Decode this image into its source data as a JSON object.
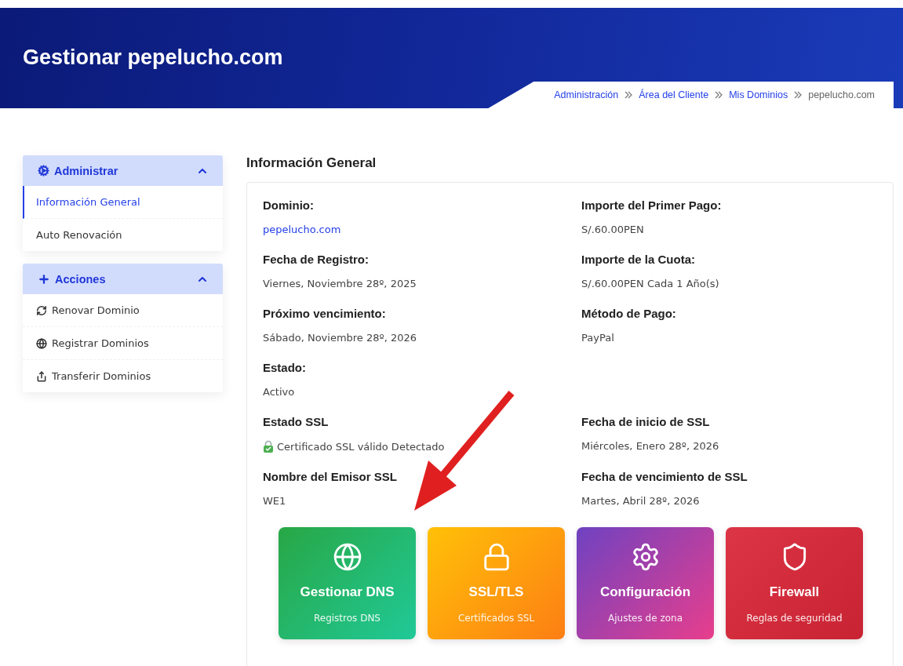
{
  "header": {
    "title": "Gestionar pepelucho.com"
  },
  "breadcrumb": [
    {
      "label": "Administración",
      "kind": "link"
    },
    {
      "label": "Área del Cliente",
      "kind": "link"
    },
    {
      "label": "Mis Dominios",
      "kind": "link"
    },
    {
      "label": "pepelucho.com",
      "kind": "current"
    }
  ],
  "sidebar": [
    {
      "title": "Administrar",
      "kind": "gear",
      "expanded": true,
      "items": [
        {
          "label": "Información General",
          "kind": "plain",
          "selected": true
        },
        {
          "label": "Auto Renovación",
          "kind": "plain",
          "selected": false
        }
      ]
    },
    {
      "title": "Acciones",
      "kind": "plus",
      "expanded": true,
      "items": [
        {
          "label": "Renovar Dominio",
          "kind": "refresh",
          "selected": false
        },
        {
          "label": "Registrar Dominios",
          "kind": "globe",
          "selected": false
        },
        {
          "label": "Transferir Dominios",
          "kind": "share",
          "selected": false
        }
      ]
    }
  ],
  "main": {
    "title": "Información General",
    "rows": [
      [
        {
          "label": "Dominio:",
          "value": "pepelucho.com",
          "kind": "link"
        },
        {
          "label": "Importe del Primer Pago:",
          "value": "S/.60.00PEN",
          "kind": "text"
        }
      ],
      [
        {
          "label": "Fecha de Registro:",
          "value": "Viernes, Noviembre 28º, 2025",
          "kind": "text"
        },
        {
          "label": "Importe de la Cuota:",
          "value": "S/.60.00PEN Cada 1 Año(s)",
          "kind": "text"
        }
      ],
      [
        {
          "label": "Próximo vencimiento:",
          "value": "Sábado, Noviembre 28º, 2026",
          "kind": "text"
        },
        {
          "label": "Método de Pago:",
          "value": "PayPal",
          "kind": "text"
        }
      ],
      [
        {
          "label": "Estado:",
          "value": "Activo",
          "kind": "text"
        }
      ],
      [
        {
          "label": "Estado SSL",
          "value": "Certificado SSL válido Detectado",
          "kind": "ssl"
        },
        {
          "label": "Fecha de inicio de SSL",
          "value": "Miércoles, Enero 28º, 2026",
          "kind": "text"
        }
      ],
      [
        {
          "label": "Nombre del Emisor SSL",
          "value": "WE1",
          "kind": "text"
        },
        {
          "label": "Fecha de vencimiento de SSL",
          "value": "Martes, Abril 28º, 2026",
          "kind": "text"
        }
      ]
    ],
    "tiles": [
      {
        "title": "Gestionar DNS",
        "subtitle": "Registros DNS",
        "kind": "dns"
      },
      {
        "title": "SSL/TLS",
        "subtitle": "Certificados SSL",
        "kind": "ssl"
      },
      {
        "title": "Configuración",
        "subtitle": "Ajustes de zona",
        "kind": "config"
      },
      {
        "title": "Firewall",
        "subtitle": "Reglas de seguridad",
        "kind": "firewall"
      }
    ]
  }
}
